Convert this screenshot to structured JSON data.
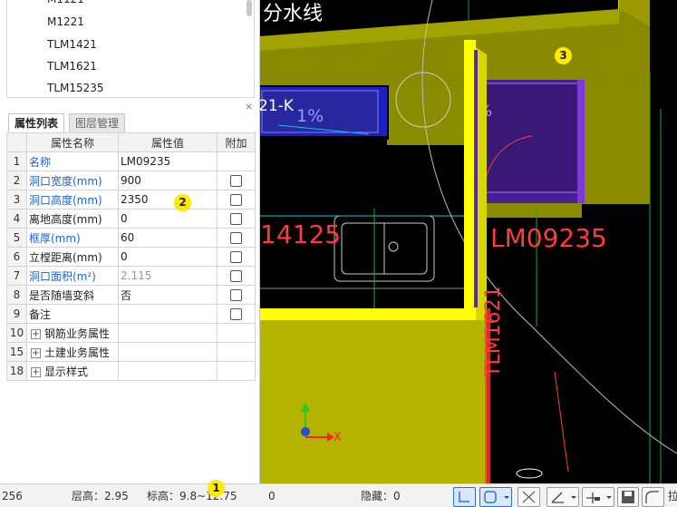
{
  "component_list": [
    "M1121",
    "M1221",
    "TLM1421",
    "TLM1621",
    "TLM15235"
  ],
  "panel": {
    "close_glyph": "×",
    "tabs": [
      "属性列表",
      "图层管理"
    ],
    "headers": [
      "属性名称",
      "属性值",
      "附加"
    ]
  },
  "properties": [
    {
      "no": "1",
      "name": "名称",
      "value": "LM09235",
      "blue": true,
      "gray": false,
      "check": false
    },
    {
      "no": "2",
      "name": "洞口宽度(mm)",
      "value": "900",
      "blue": true,
      "gray": false,
      "check": true
    },
    {
      "no": "3",
      "name": "洞口高度(mm)",
      "value": "2350",
      "blue": true,
      "gray": false,
      "check": true
    },
    {
      "no": "4",
      "name": "离地高度(mm)",
      "value": "0",
      "blue": false,
      "gray": false,
      "check": true
    },
    {
      "no": "5",
      "name": "框厚(mm)",
      "value": "60",
      "blue": true,
      "gray": false,
      "check": true
    },
    {
      "no": "6",
      "name": "立樘距离(mm)",
      "value": "0",
      "blue": false,
      "gray": false,
      "check": true
    },
    {
      "no": "7",
      "name": "洞口面积(m²)",
      "value": "2.115",
      "blue": true,
      "gray": true,
      "check": true
    },
    {
      "no": "8",
      "name": "是否随墙变斜",
      "value": "否",
      "blue": false,
      "gray": false,
      "check": true
    },
    {
      "no": "9",
      "name": "备注",
      "value": "",
      "blue": false,
      "gray": false,
      "check": true
    },
    {
      "no": "10",
      "name": "钢筋业务属性",
      "value": "",
      "blue": false,
      "gray": false,
      "check": false,
      "group": true
    },
    {
      "no": "15",
      "name": "土建业务属性",
      "value": "",
      "blue": false,
      "gray": false,
      "check": false,
      "group": true
    },
    {
      "no": "18",
      "name": "显示样式",
      "value": "",
      "blue": false,
      "gray": false,
      "check": false,
      "group": true
    }
  ],
  "markers": [
    "1",
    "2",
    "3"
  ],
  "cad": {
    "top_text": "分水线",
    "room_label": "21-K",
    "slope_left": "1%",
    "slope_right": "%",
    "left_label": "14125",
    "door_label": "LM09235",
    "vertical_label": "TLM1621",
    "axis_y": "Y",
    "axis_x": "X"
  },
  "status": {
    "left_value": "256",
    "floor_height": "层高：2.95",
    "elevation": "标高：9.8~12.75",
    "zero": "0",
    "hidden": "隐藏：0",
    "tail": "拉"
  },
  "colors": {
    "wall": "#b5b500",
    "wall_dark": "#7a7a00",
    "highlight": "#ffff00",
    "red_text": "#ff3b3b",
    "blue_fill": "#2a2ad8",
    "purple_fill": "#5b2a9f",
    "link_blue": "#1f5fd6"
  }
}
